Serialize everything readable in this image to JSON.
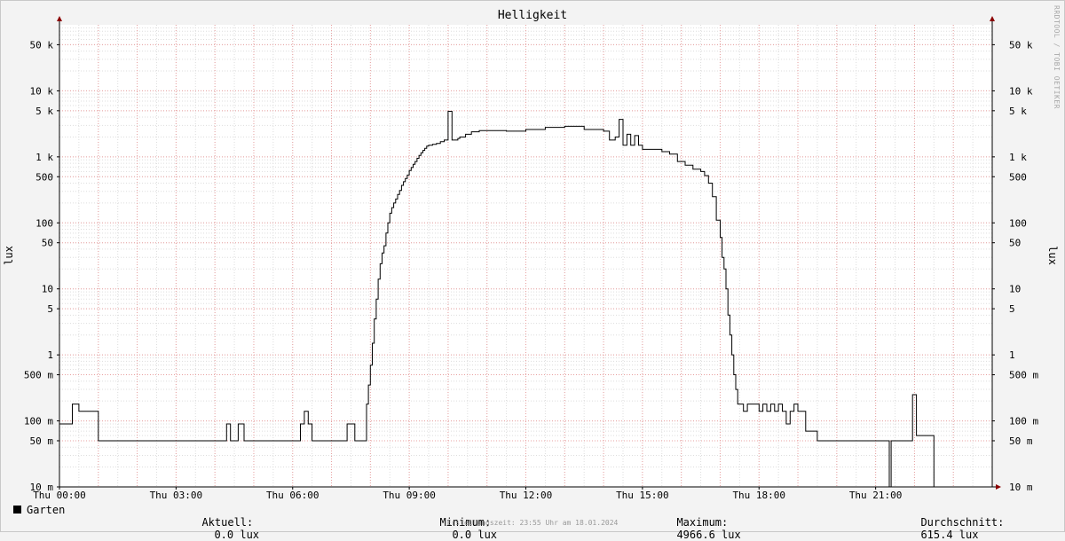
{
  "title": "Helligkeit",
  "watermark": "RRDTOOL / TOBI OETIKER",
  "creation_text": "Erstellungszeit: 23:55 Uhr am 18.01.2024",
  "legend": {
    "series_name": "Garten",
    "current_label": "Aktuell:",
    "current_value": "0.0 lux",
    "min_label": "Minimum:",
    "min_value": "0.0 lux",
    "max_label": "Maximum:",
    "max_value": "4966.6 lux",
    "avg_label": "Durchschnitt:",
    "avg_value": "615.4 lux"
  },
  "colors": {
    "background": "#f3f3f3",
    "canvas": "#ffffff",
    "grid_major": "#e8a0a0",
    "grid_minor": "#dddddd",
    "line": "#000000",
    "arrow": "#8b0000"
  },
  "chart_data": {
    "type": "line",
    "title": "Helligkeit",
    "ylabel": "lux",
    "xlabel": "",
    "y_scale": "log",
    "ylim": [
      0.01,
      100000
    ],
    "xlim": [
      0,
      24
    ],
    "x_unit": "hours",
    "grid": true,
    "x_ticks": [
      {
        "value": 0,
        "label": "Thu 00:00"
      },
      {
        "value": 3,
        "label": "Thu 03:00"
      },
      {
        "value": 6,
        "label": "Thu 06:00"
      },
      {
        "value": 9,
        "label": "Thu 09:00"
      },
      {
        "value": 12,
        "label": "Thu 12:00"
      },
      {
        "value": 15,
        "label": "Thu 15:00"
      },
      {
        "value": 18,
        "label": "Thu 18:00"
      },
      {
        "value": 21,
        "label": "Thu 21:00"
      }
    ],
    "y_ticks": [
      {
        "value": 0.01,
        "label": "10 m"
      },
      {
        "value": 0.05,
        "label": "50 m"
      },
      {
        "value": 0.1,
        "label": "100 m"
      },
      {
        "value": 0.5,
        "label": "500 m"
      },
      {
        "value": 1,
        "label": "1"
      },
      {
        "value": 5,
        "label": "5"
      },
      {
        "value": 10,
        "label": "10"
      },
      {
        "value": 50,
        "label": "50"
      },
      {
        "value": 100,
        "label": "100"
      },
      {
        "value": 500,
        "label": "500"
      },
      {
        "value": 1000,
        "label": "1 k"
      },
      {
        "value": 5000,
        "label": "5 k"
      },
      {
        "value": 10000,
        "label": "10 k"
      },
      {
        "value": 50000,
        "label": "50 k"
      }
    ],
    "series": [
      {
        "name": "Garten",
        "step": true,
        "x": [
          0,
          0.17,
          0.33,
          0.5,
          0.67,
          1.0,
          4.2,
          4.3,
          4.4,
          4.5,
          4.6,
          4.75,
          5.0,
          5.5,
          6.2,
          6.3,
          6.4,
          6.5,
          7.0,
          7.2,
          7.4,
          7.6,
          7.85,
          7.9,
          7.95,
          8.0,
          8.05,
          8.1,
          8.15,
          8.2,
          8.25,
          8.3,
          8.35,
          8.4,
          8.45,
          8.5,
          8.55,
          8.6,
          8.65,
          8.7,
          8.75,
          8.8,
          8.85,
          8.9,
          8.95,
          9.0,
          9.05,
          9.1,
          9.15,
          9.2,
          9.25,
          9.3,
          9.35,
          9.4,
          9.45,
          9.5,
          9.6,
          9.7,
          9.8,
          9.9,
          10.0,
          10.1,
          10.2,
          10.25,
          10.3,
          10.45,
          10.6,
          10.8,
          11.0,
          11.5,
          12.0,
          12.5,
          13.0,
          13.5,
          14.0,
          14.15,
          14.3,
          14.4,
          14.5,
          14.6,
          14.7,
          14.8,
          14.9,
          15.0,
          15.2,
          15.5,
          15.7,
          15.9,
          16.1,
          16.3,
          16.5,
          16.6,
          16.7,
          16.8,
          16.9,
          17.0,
          17.05,
          17.1,
          17.15,
          17.2,
          17.25,
          17.3,
          17.35,
          17.4,
          17.45,
          17.5,
          17.55,
          17.6,
          17.7,
          18.0,
          18.1,
          18.2,
          18.3,
          18.4,
          18.5,
          18.6,
          18.7,
          18.8,
          18.9,
          19.0,
          19.2,
          19.5,
          20.0,
          20.5,
          21.0,
          21.35,
          21.4,
          21.6,
          21.9,
          21.95,
          22.05,
          22.5,
          24.0
        ],
        "values": [
          0.09,
          0.09,
          0.18,
          0.14,
          0.14,
          0.05,
          0.05,
          0.09,
          0.05,
          0.05,
          0.09,
          0.05,
          0.05,
          0.05,
          0.09,
          0.14,
          0.09,
          0.05,
          0.05,
          0.05,
          0.09,
          0.05,
          0.05,
          0.18,
          0.35,
          0.7,
          1.5,
          3.5,
          7,
          14,
          24,
          35,
          45,
          70,
          100,
          140,
          170,
          200,
          230,
          270,
          310,
          370,
          420,
          470,
          530,
          620,
          690,
          770,
          850,
          950,
          1050,
          1150,
          1250,
          1350,
          1450,
          1500,
          1550,
          1600,
          1700,
          1800,
          4900,
          1800,
          1800,
          1900,
          2000,
          2200,
          2400,
          2500,
          2500,
          2450,
          2600,
          2800,
          2900,
          2600,
          2450,
          1800,
          2000,
          3700,
          1500,
          2200,
          1500,
          2100,
          1500,
          1300,
          1300,
          1200,
          1100,
          850,
          750,
          650,
          600,
          520,
          400,
          250,
          110,
          60,
          30,
          20,
          10,
          4,
          2,
          1,
          0.5,
          0.3,
          0.18,
          0.18,
          0.18,
          0.14,
          0.18,
          0.14,
          0.18,
          0.14,
          0.18,
          0.14,
          0.18,
          0.14,
          0.09,
          0.14,
          0.18,
          0.14,
          0.07,
          0.05,
          0.05,
          0.05,
          0.05,
          0.0,
          0.05,
          0.05,
          0.05,
          0.25,
          0.06,
          0.0,
          0.0
        ]
      }
    ]
  }
}
